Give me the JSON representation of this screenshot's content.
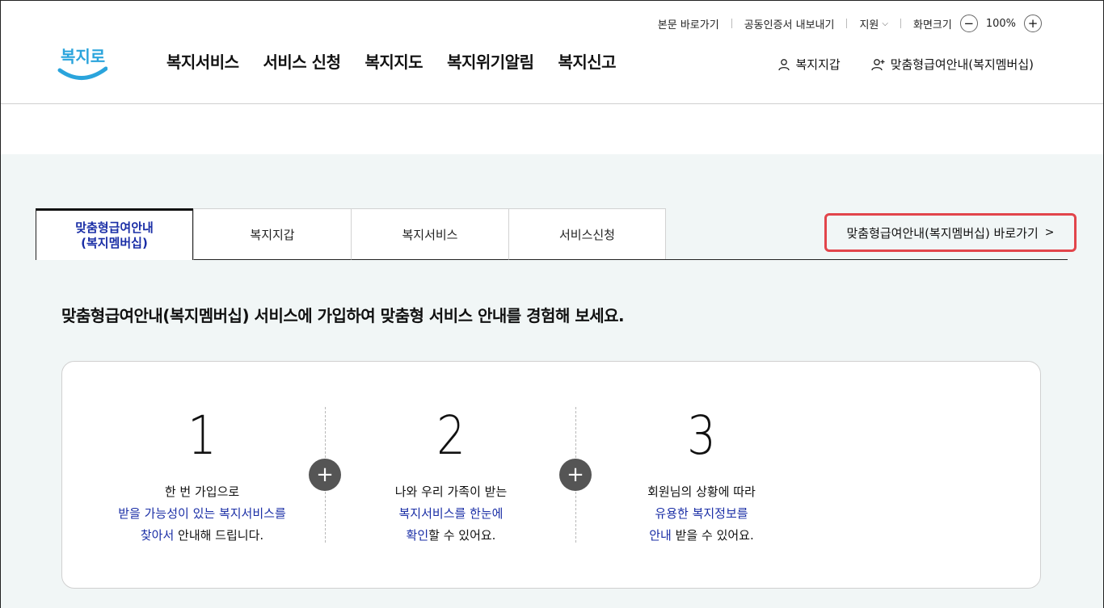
{
  "util": {
    "skip": "본문 바로가기",
    "cert": "공동인증서 내보내기",
    "support": "지원",
    "zoom_label": "화면크기",
    "zoom_minus": "−",
    "zoom_value": "100%",
    "zoom_plus": "+"
  },
  "logo": {
    "text": "복지로"
  },
  "gnb": {
    "items": [
      "복지서비스",
      "서비스 신청",
      "복지지도",
      "복지위기알림",
      "복지신고"
    ]
  },
  "account": {
    "wallet": "복지지갑",
    "membership": "맞춤형급여안내(복지멤버십)"
  },
  "tabs": {
    "items": [
      {
        "line1": "맞춤형급여안내",
        "line2": "(복지멤버십)"
      },
      {
        "line1": "복지지갑"
      },
      {
        "line1": "복지서비스"
      },
      {
        "line1": "서비스신청"
      }
    ]
  },
  "shortcut": {
    "label": "맞춤형급여안내(복지멤버십) 바로가기",
    "arrow": ">"
  },
  "headline": "맞춤형급여안내(복지멤버십) 서비스에 가입하여 맞춤형 서비스 안내를 경험해 보세요.",
  "steps": [
    {
      "num": "1",
      "l1": "한 번 가입으로",
      "l2": "받을 가능성이 있는 복지서비스를",
      "l3a": "찾아서",
      "l3b": " 안내해 드립니다."
    },
    {
      "num": "2",
      "l1": "나와 우리 가족이 받는",
      "l2": "복지서비스를 한눈에",
      "l3a": "확인",
      "l3b": "할 수 있어요."
    },
    {
      "num": "3",
      "l1": "회원님의 상황에 따라",
      "l2": "유용한 복지정보를",
      "l3a": "안내",
      "l3b": " 받을 수 있어요."
    }
  ],
  "plus_sign": "+",
  "colors": {
    "accent": "#1a2ea6",
    "highlight_border": "#e2454b",
    "bg_mint": "#f1f6f6"
  }
}
